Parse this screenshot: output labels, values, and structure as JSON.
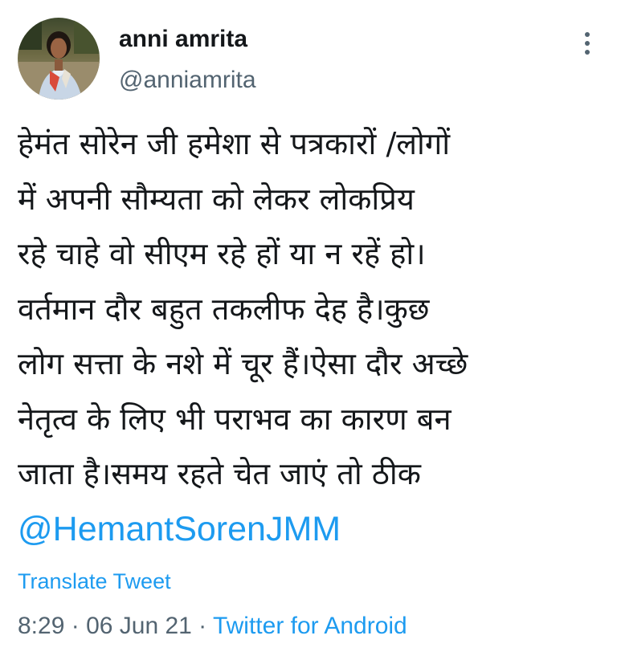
{
  "user": {
    "display_name": "anni amrita",
    "handle": "@anniamrita",
    "avatar_icon": "profile-photo"
  },
  "more_icon": "vertical-ellipsis-icon",
  "tweet": {
    "lines": [
      "हेमंत सोरेन जी हमेशा से पत्रकारों /लोगों",
      "में अपनी सौम्यता को लेकर लोकप्रिय",
      "रहे चाहे वो सीएम रहे हों या न रहें हो।",
      "वर्तमान दौर बहुत तकलीफ देह है।कुछ",
      "लोग सत्ता के नशे में चूर हैं।ऐसा दौर अच्छे",
      "नेतृत्व के लिए भी पराभव का कारण बन",
      "जाता है।समय रहते चेत जाएं तो ठीक"
    ],
    "mention": "@HemantSorenJMM"
  },
  "translate_label": "Translate Tweet",
  "meta": {
    "time": "8:29",
    "separator1": " · ",
    "date": "06 Jun 21",
    "separator2": " · ",
    "source": "Twitter for Android"
  },
  "colors": {
    "link": "#1d9bf0",
    "secondary": "#536471",
    "text": "#14171a"
  }
}
